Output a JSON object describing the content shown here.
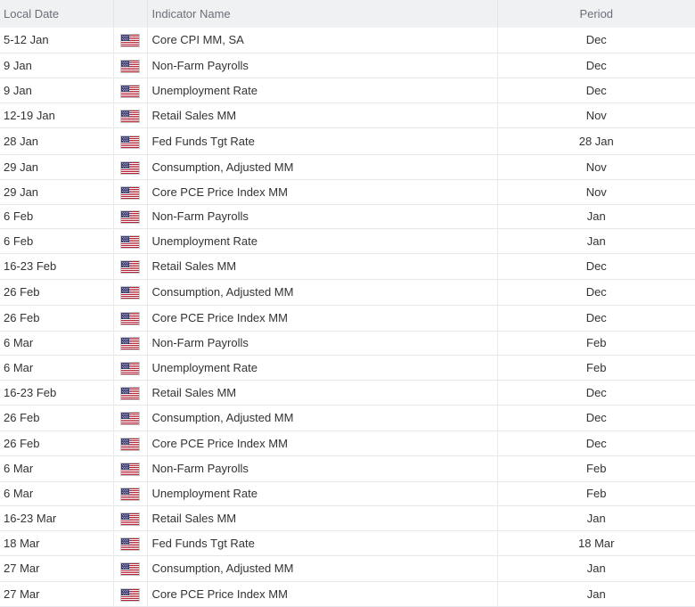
{
  "table": {
    "headers": {
      "date": "Local Date",
      "flag": "",
      "name": "Indicator Name",
      "period": "Period"
    },
    "rows": [
      {
        "date": "5-12 Jan",
        "country": "us-flag-icon",
        "name": "Core CPI MM, SA",
        "period": "Dec",
        "h": 28
      },
      {
        "date": "9 Jan",
        "country": "us-flag-icon",
        "name": "Non-Farm Payrolls",
        "period": "Dec",
        "h": 28
      },
      {
        "date": "9 Jan",
        "country": "us-flag-icon",
        "name": "Unemployment Rate",
        "period": "Dec",
        "h": 28
      },
      {
        "date": "12-19 Jan",
        "country": "us-flag-icon",
        "name": "Retail Sales MM",
        "period": "Nov",
        "h": 28
      },
      {
        "date": "28 Jan",
        "country": "us-flag-icon",
        "name": "Fed Funds Tgt Rate",
        "period": "28 Jan",
        "h": 30
      },
      {
        "date": "29 Jan",
        "country": "us-flag-icon",
        "name": "Consumption, Adjusted MM",
        "period": "Nov",
        "h": 28
      },
      {
        "date": "29 Jan",
        "country": "us-flag-icon",
        "name": "Core PCE Price Index MM",
        "period": "Nov",
        "h": 28
      },
      {
        "date": "6 Feb",
        "country": "us-flag-icon",
        "name": "Non-Farm Payrolls",
        "period": "Jan",
        "h": 27
      },
      {
        "date": "6 Feb",
        "country": "us-flag-icon",
        "name": "Unemployment Rate",
        "period": "Jan",
        "h": 28
      },
      {
        "date": "16-23 Feb",
        "country": "us-flag-icon",
        "name": "Retail Sales MM",
        "period": "Dec",
        "h": 29
      },
      {
        "date": "26 Feb",
        "country": "us-flag-icon",
        "name": "Consumption, Adjusted MM",
        "period": "Dec",
        "h": 29
      },
      {
        "date": "26 Feb",
        "country": "us-flag-icon",
        "name": "Core PCE Price Index MM",
        "period": "Dec",
        "h": 29
      },
      {
        "date": "6 Mar",
        "country": "us-flag-icon",
        "name": "Non-Farm Payrolls",
        "period": "Feb",
        "h": 27
      },
      {
        "date": "6 Mar",
        "country": "us-flag-icon",
        "name": "Unemployment Rate",
        "period": "Feb",
        "h": 28
      },
      {
        "date": "16-23 Feb",
        "country": "us-flag-icon",
        "name": "Retail Sales MM",
        "period": "Dec",
        "h": 28
      },
      {
        "date": "26 Feb",
        "country": "us-flag-icon",
        "name": "Consumption, Adjusted MM",
        "period": "Dec",
        "h": 29
      },
      {
        "date": "26 Feb",
        "country": "us-flag-icon",
        "name": "Core PCE Price Index MM",
        "period": "Dec",
        "h": 28
      },
      {
        "date": "6 Mar",
        "country": "us-flag-icon",
        "name": "Non-Farm Payrolls",
        "period": "Feb",
        "h": 29
      },
      {
        "date": "6 Mar",
        "country": "us-flag-icon",
        "name": "Unemployment Rate",
        "period": "Feb",
        "h": 27
      },
      {
        "date": "16-23 Mar",
        "country": "us-flag-icon",
        "name": "Retail Sales MM",
        "period": "Jan",
        "h": 28
      },
      {
        "date": "18 Mar",
        "country": "us-flag-icon",
        "name": "Fed Funds Tgt Rate",
        "period": "18 Mar",
        "h": 28
      },
      {
        "date": "27 Mar",
        "country": "us-flag-icon",
        "name": "Consumption, Adjusted MM",
        "period": "Jan",
        "h": 29
      },
      {
        "date": "27 Mar",
        "country": "us-flag-icon",
        "name": "Core PCE Price Index MM",
        "period": "Jan",
        "h": 28
      }
    ]
  },
  "colors": {
    "header_bg": "#f0f1f3",
    "header_text": "#6a6f77",
    "body_text": "#333333",
    "row_border": "#e6e7ea",
    "flag_red": "#b22234",
    "flag_blue": "#3c3b6e"
  }
}
